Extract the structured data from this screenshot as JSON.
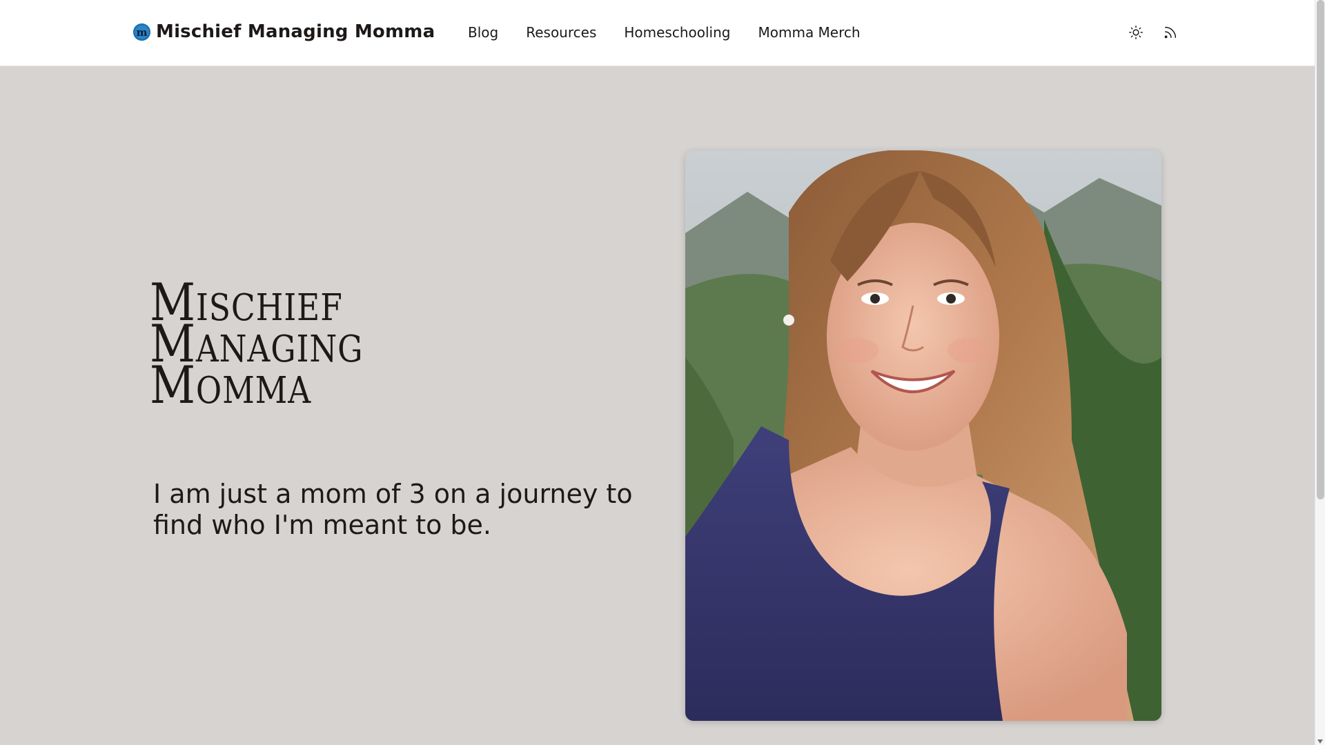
{
  "site": {
    "brand_name": "Mischief Managing Momma",
    "logo_letter": "m",
    "logo_icon": "brand-logo-icon"
  },
  "nav": {
    "items": [
      {
        "label": "Blog"
      },
      {
        "label": "Resources"
      },
      {
        "label": "Homeschooling"
      },
      {
        "label": "Momma Merch"
      }
    ]
  },
  "header_icons": {
    "theme_toggle": "sun-icon",
    "rss": "rss-icon"
  },
  "hero": {
    "title_lines": [
      "Mischief",
      "Managing",
      "Momma"
    ],
    "tagline": "I am just a mom of 3 on a journey to find who I'm meant to be.",
    "photo": "portrait-photo"
  },
  "colors": {
    "background": "#d6d3d1",
    "header_bg": "#ffffff",
    "text": "#1c1917",
    "logo_blue": "#1f6fb0"
  }
}
